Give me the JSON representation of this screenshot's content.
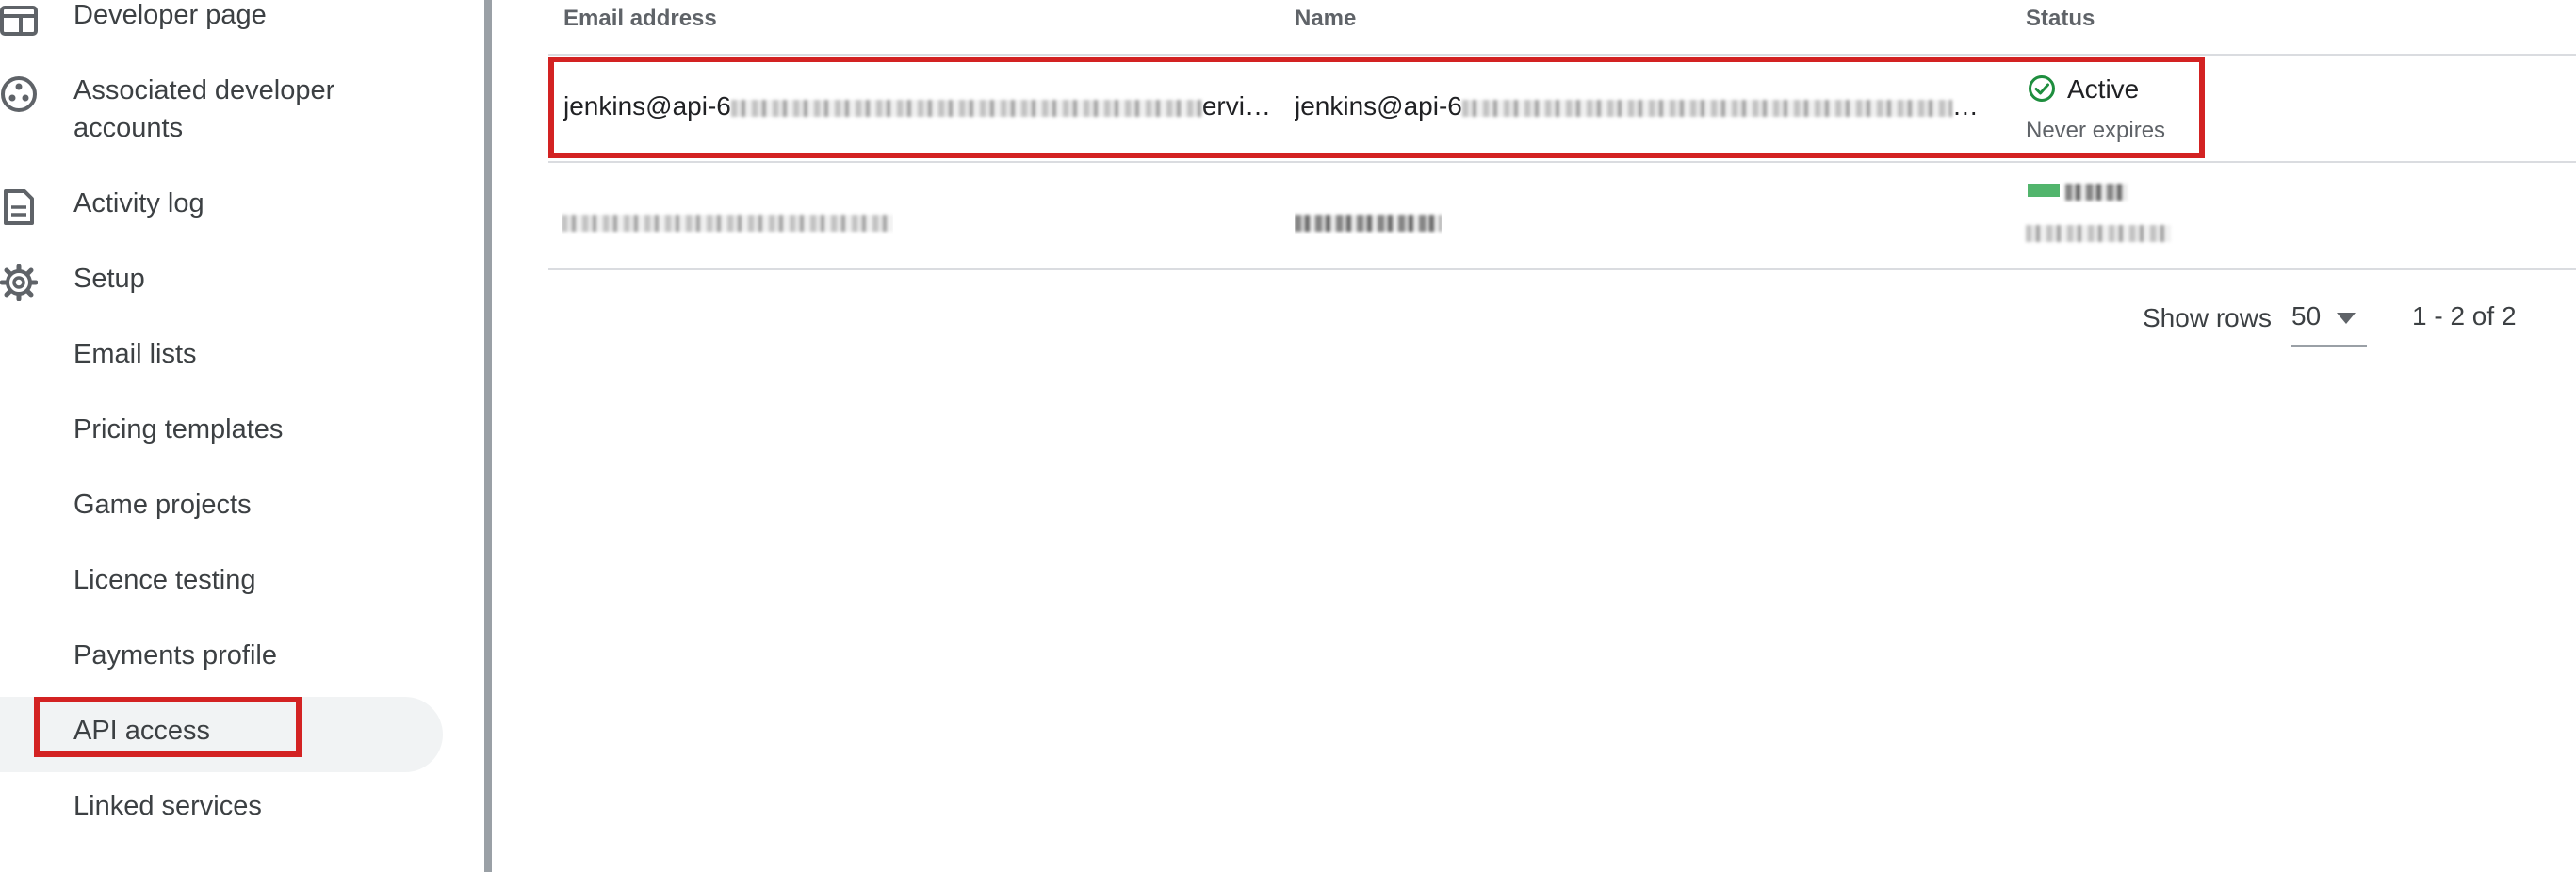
{
  "sidebar": {
    "items": [
      {
        "label": "Developer page",
        "icon": "web-icon"
      },
      {
        "label": "Associated developer accounts",
        "icon": "group-icon"
      },
      {
        "label": "Activity log",
        "icon": "document-icon"
      },
      {
        "label": "Setup",
        "icon": "gear-icon"
      },
      {
        "label": "Email lists"
      },
      {
        "label": "Pricing templates"
      },
      {
        "label": "Game projects"
      },
      {
        "label": "Licence testing"
      },
      {
        "label": "Payments profile"
      },
      {
        "label": "API access",
        "selected": true
      },
      {
        "label": "Linked services"
      }
    ],
    "associated_line1": "Associated developer",
    "associated_line2": "accounts"
  },
  "table": {
    "headers": {
      "email": "Email address",
      "name": "Name",
      "status": "Status"
    },
    "rows": [
      {
        "email_prefix": "jenkins@api-6",
        "email_suffix": "ervi…",
        "name_prefix": "jenkins@api-6",
        "name_suffix": "…",
        "status": "Active",
        "status_sub": "Never expires"
      },
      {
        "email_prefix": "",
        "name_prefix": "",
        "status": "",
        "status_sub": ""
      }
    ]
  },
  "pagination": {
    "show_rows_label": "Show rows",
    "rows_value": "50",
    "range": "1 - 2 of 2"
  },
  "colors": {
    "highlight": "#d32222",
    "active_green": "#1e8e3e",
    "divider": "#dadce0"
  }
}
